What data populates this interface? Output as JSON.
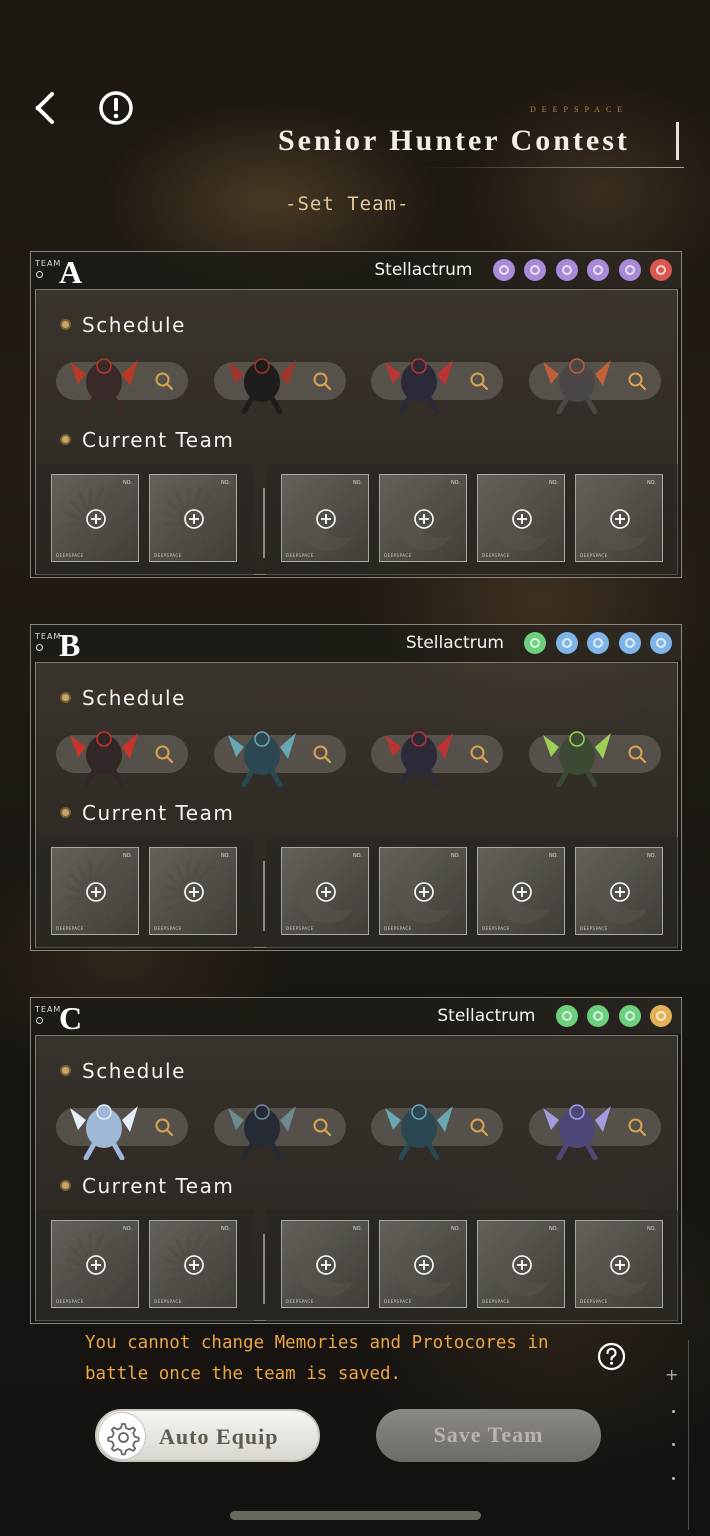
{
  "header": {
    "brand": "DEEPSPACE",
    "title": "Senior Hunter Contest",
    "subtitle": "-Set Team-"
  },
  "teams": [
    {
      "tag": "TEAM",
      "letter": "A",
      "stellactrum_label": "Stellactrum",
      "orbs": [
        "#a98ad8",
        "#a98ad8",
        "#a98ad8",
        "#a98ad8",
        "#a98ad8",
        "#d9574f"
      ],
      "schedule_label": "Schedule",
      "current_team_label": "Current Team",
      "enemies": [
        "red-crab-wanderer",
        "black-mecha-wanderer",
        "dark-humanoid-wanderer",
        "grey-golem-wanderer"
      ]
    },
    {
      "tag": "TEAM",
      "letter": "B",
      "stellactrum_label": "Stellactrum",
      "orbs": [
        "#6bcf7e",
        "#7fb4e8",
        "#7fb4e8",
        "#7fb4e8",
        "#7fb4e8"
      ],
      "schedule_label": "Schedule",
      "current_team_label": "Current Team",
      "enemies": [
        "red-scorpion-wanderer",
        "teal-serpent-wanderer",
        "dark-humanoid-wanderer",
        "green-golem-wanderer"
      ]
    },
    {
      "tag": "TEAM",
      "letter": "C",
      "stellactrum_label": "Stellactrum",
      "orbs": [
        "#6bcf7e",
        "#6bcf7e",
        "#6bcf7e",
        "#e2b055"
      ],
      "schedule_label": "Schedule",
      "current_team_label": "Current Team",
      "enemies": [
        "ice-dragon-wanderer",
        "armored-knight-wanderer",
        "teal-serpent-wanderer",
        "purple-crystal-wanderer"
      ]
    }
  ],
  "slot": {
    "no_label": "NO.",
    "brand_label": "DEEPSPACE"
  },
  "notice": "You cannot change Memories and Protocores in battle once the team is saved.",
  "buttons": {
    "auto_equip": "Auto Equip",
    "save_team": "Save Team"
  },
  "colors": {
    "accent_text": "#eaa545",
    "title_text": "#f3efe8",
    "subtitle_text": "#e2c89a"
  }
}
